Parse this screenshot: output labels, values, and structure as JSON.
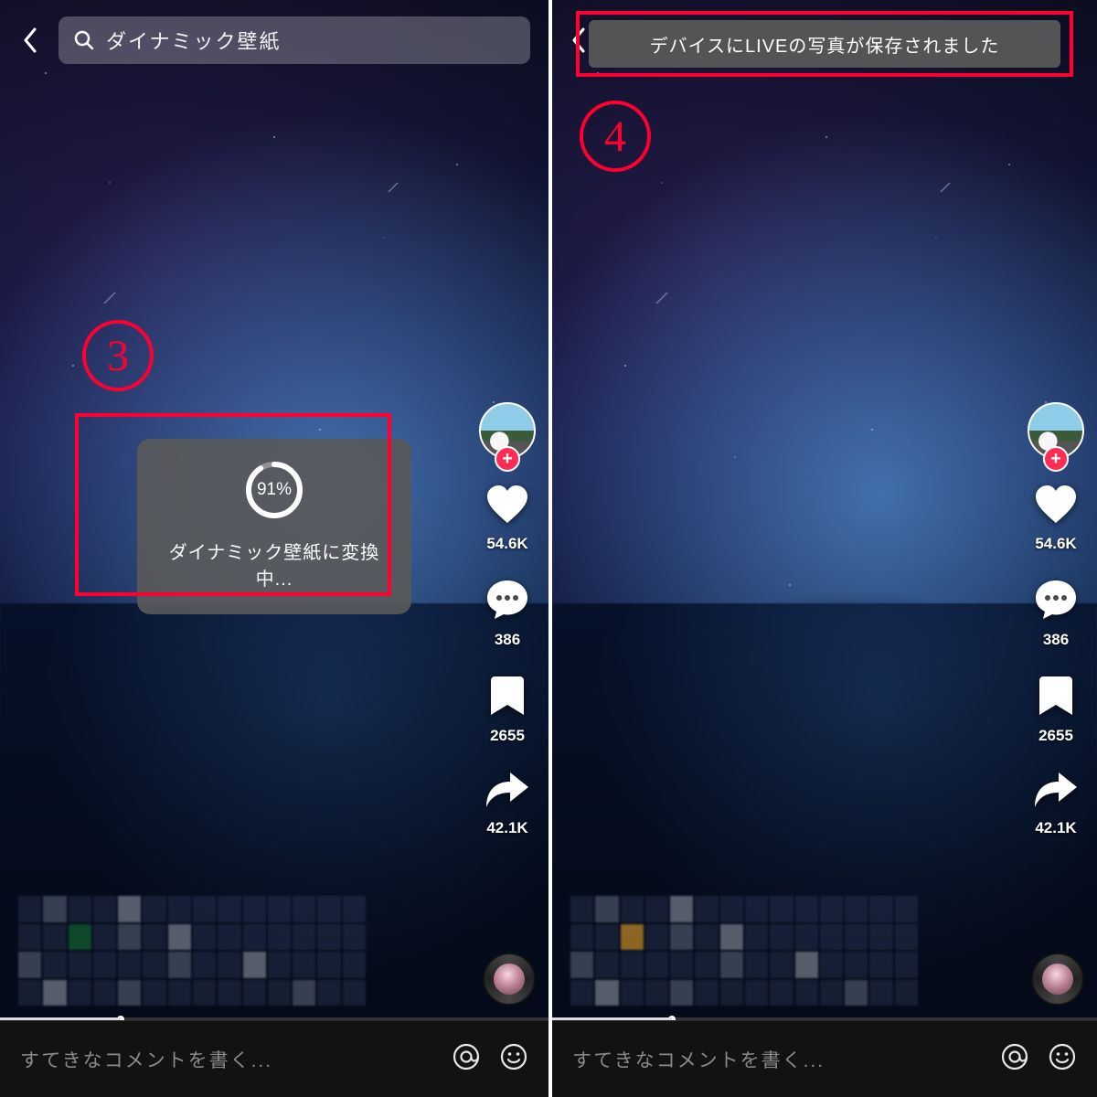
{
  "left": {
    "step_number": "3",
    "search": {
      "query": "ダイナミック壁紙"
    },
    "progress": {
      "percent_text": "91%",
      "message": "ダイナミック壁紙に変換中..."
    },
    "actions": {
      "likes": "54.6K",
      "comments": "386",
      "bookmarks": "2655",
      "shares": "42.1K"
    },
    "comment_placeholder": "すてきなコメントを書く..."
  },
  "right": {
    "step_number": "4",
    "toast": "デバイスにLIVEの写真が保存されました",
    "actions": {
      "likes": "54.6K",
      "comments": "386",
      "bookmarks": "2655",
      "shares": "42.1K"
    },
    "comment_placeholder": "すてきなコメントを書く..."
  },
  "colors": {
    "annotation": "#ff0030",
    "accent": "#fe2c55"
  }
}
